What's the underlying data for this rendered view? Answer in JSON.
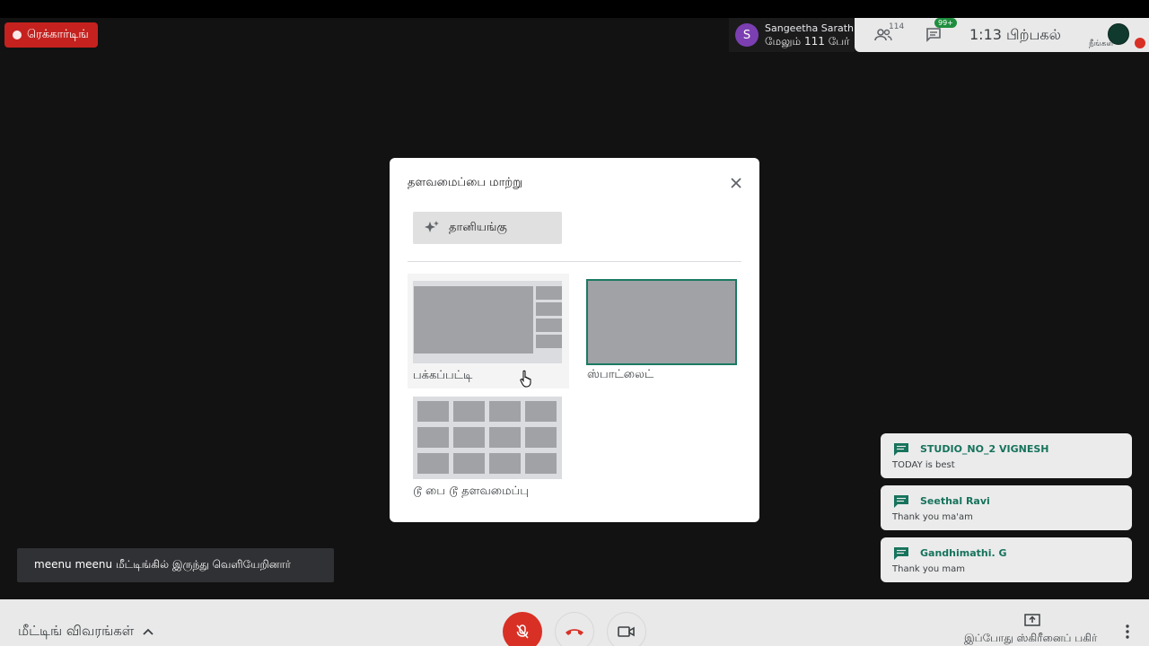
{
  "recording": {
    "label": "ரெக்கார்டிங்"
  },
  "presenter": {
    "initial": "S",
    "name": "Sangeetha Sarath",
    "subtitle": "மேலும் 111 பேர்"
  },
  "topbar": {
    "people_icon": "people-icon",
    "participant_count": "114",
    "chat_icon": "chat-icon",
    "chat_badge": "99+",
    "time": "1:13 பிற்பகல்",
    "self_label": "நீங்கள்"
  },
  "dialog": {
    "title": "தளவமைப்பை மாற்று",
    "close_icon": "close-icon",
    "auto_label": "தானியங்கு",
    "options": [
      {
        "label": "பக்கப்பட்டி"
      },
      {
        "label": "ஸ்பாட்லைட்"
      },
      {
        "label": "டூ பை டூ தளவமைப்பு"
      }
    ]
  },
  "toast": {
    "text": "meenu meenu மீட்டிங்கில் இருந்து வெளியேறினார்"
  },
  "messages": [
    {
      "author": "STUDIO_NO_2 VIGNESH",
      "text": "TODAY is best"
    },
    {
      "author": "Seethal Ravi",
      "text": "Thank you ma'am"
    },
    {
      "author": "Gandhimathi. G",
      "text": "Thank you mam"
    }
  ],
  "bottombar": {
    "details_label": "மீட்டிங் விவரங்கள்",
    "present_label": "இப்போது ஸ்கிரீனைப் பகிர்"
  },
  "colors": {
    "accent": "#1b7a63",
    "record_red": "#c5221f",
    "mic_red": "#d93025",
    "author_green": "#16735c"
  }
}
